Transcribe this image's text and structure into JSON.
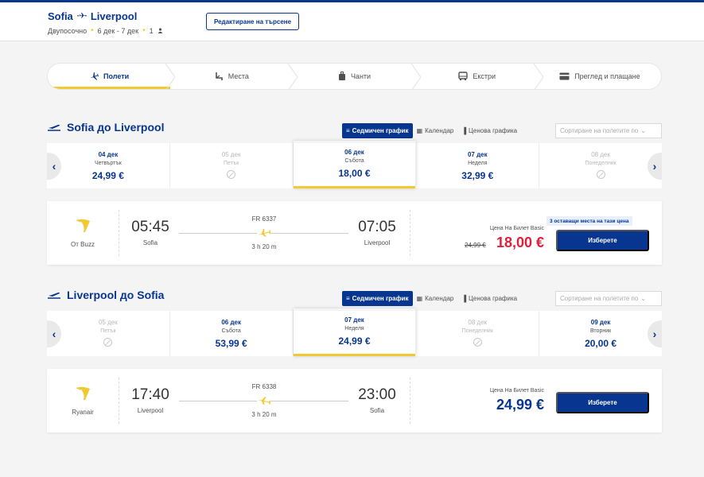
{
  "header": {
    "origin": "Sofia",
    "destination": "Liverpool",
    "trip_type": "Двупосочно",
    "dates": "6 дек - 7 дек",
    "passengers": "1",
    "edit_label": "Редактиране на търсене"
  },
  "steps": [
    {
      "label": "Полети",
      "icon": "plane-icon",
      "active": true
    },
    {
      "label": "Места",
      "icon": "seat-icon",
      "active": false
    },
    {
      "label": "Чанти",
      "icon": "bag-icon",
      "active": false
    },
    {
      "label": "Екстри",
      "icon": "bus-icon",
      "active": false
    },
    {
      "label": "Преглед и плащане",
      "icon": "card-icon",
      "active": false
    }
  ],
  "view_tabs": {
    "weekly": "Седмичен график",
    "calendar": "Календар",
    "price_graph": "Ценова графика",
    "sort_placeholder": "Сортиране на полетите по"
  },
  "outbound": {
    "title": "Sofia до Liverpool",
    "dates": [
      {
        "date": "04 дек",
        "weekday": "Четвъртък",
        "price": "24,99 €",
        "available": true
      },
      {
        "date": "05 дек",
        "weekday": "Петък",
        "price": "",
        "available": false
      },
      {
        "date": "06 дек",
        "weekday": "Събота",
        "price": "18,00 €",
        "available": true,
        "selected": true
      },
      {
        "date": "07 дек",
        "weekday": "Неделя",
        "price": "32,99 €",
        "available": true
      },
      {
        "date": "08 дек",
        "weekday": "Понеделник",
        "price": "",
        "available": false
      }
    ],
    "flight": {
      "carrier": "От Buzz",
      "dep_time": "05:45",
      "dep_city": "Sofia",
      "arr_time": "07:05",
      "arr_city": "Liverpool",
      "number": "FR 6337",
      "duration": "3 h 20 m",
      "fare_label": "Цена На Билет Basic",
      "old_price": "24,99 €",
      "price": "18,00 €",
      "seats_badge": "3 оставащи места на тази цена",
      "select_label": "Изберете"
    }
  },
  "inbound": {
    "title": "Liverpool до Sofia",
    "dates": [
      {
        "date": "05 дек",
        "weekday": "Петък",
        "price": "",
        "available": false
      },
      {
        "date": "06 дек",
        "weekday": "Събота",
        "price": "53,99 €",
        "available": true
      },
      {
        "date": "07 дек",
        "weekday": "Неделя",
        "price": "24,99 €",
        "available": true,
        "selected": true
      },
      {
        "date": "08 дек",
        "weekday": "Понеделник",
        "price": "",
        "available": false
      },
      {
        "date": "09 дек",
        "weekday": "Вторник",
        "price": "20,00 €",
        "available": true
      }
    ],
    "flight": {
      "carrier": "Ryanair",
      "dep_time": "17:40",
      "dep_city": "Liverpool",
      "arr_time": "23:00",
      "arr_city": "Sofia",
      "number": "FR 6338",
      "duration": "3 h 20 m",
      "fare_label": "Цена На Билет Basic",
      "price": "24,99 €",
      "select_label": "Изберете"
    }
  },
  "colors": {
    "brand": "#073590",
    "accent": "#f1c933",
    "sale": "#e41e3a"
  }
}
